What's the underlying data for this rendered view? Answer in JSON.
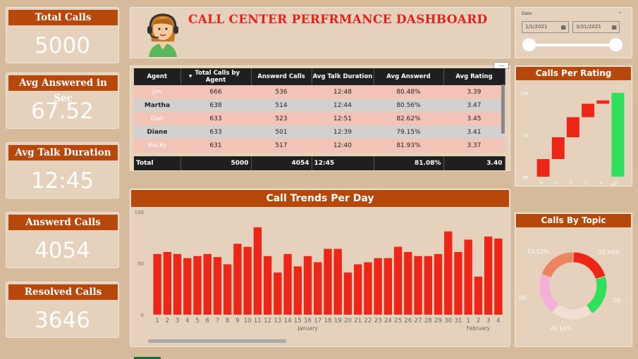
{
  "kpis": [
    {
      "title": "Total Calls",
      "value": "5000"
    },
    {
      "title": "Avg Answered in Sec",
      "value": "67.52"
    },
    {
      "title": "Avg Talk Duration",
      "value": "12:45"
    },
    {
      "title": "Answerd Calls",
      "value": "4054"
    },
    {
      "title": "Resolved Calls",
      "value": "3646"
    }
  ],
  "header": {
    "title": "CALL CENTER PERFRMANCE DASHBOARD"
  },
  "date_slicer": {
    "label": "Date",
    "start": "1/1/2021",
    "end": "3/31/2021",
    "calendar_icon": "calendar-icon"
  },
  "agent_table": {
    "columns": [
      "Agent",
      "Total Calls by Agent",
      "Answerd Calls",
      "Avg Talk Duration",
      "Avg Answerd",
      "Avg Rating"
    ],
    "rows": [
      [
        "Jim",
        "666",
        "536",
        "12:48",
        "80.48%",
        "3.39"
      ],
      [
        "Martha",
        "638",
        "514",
        "12:44",
        "80.56%",
        "3.47"
      ],
      [
        "Dan",
        "633",
        "523",
        "12:51",
        "82.62%",
        "3.45"
      ],
      [
        "Diane",
        "633",
        "501",
        "12:39",
        "79.15%",
        "3.41"
      ],
      [
        "Becky",
        "631",
        "517",
        "12:40",
        "81.93%",
        "3.37"
      ]
    ],
    "total": [
      "Total",
      "5000",
      "4054",
      "12:45",
      "81.08%",
      "3.40"
    ],
    "more_label": "..."
  },
  "colors": {
    "accent": "#b5480a",
    "bar": "#ee2617",
    "positive": "#2fe05c",
    "title_red": "#e5211d"
  },
  "chart_data": [
    {
      "type": "bar",
      "title": "Call Trends Per Day",
      "categories": [
        "1",
        "2",
        "3",
        "4",
        "5",
        "6",
        "7",
        "8",
        "9",
        "10",
        "11",
        "12",
        "13",
        "14",
        "15",
        "16",
        "17",
        "18",
        "19",
        "20",
        "21",
        "22",
        "23",
        "24",
        "25",
        "26",
        "27",
        "28",
        "29",
        "30",
        "31",
        "1",
        "2",
        "3",
        "4"
      ],
      "values": [
        59,
        61,
        59,
        55,
        57,
        59,
        56,
        49,
        69,
        66,
        85,
        57,
        41,
        59,
        47,
        57,
        51,
        64,
        64,
        41,
        49,
        51,
        55,
        55,
        66,
        61,
        57,
        57,
        59,
        81,
        61,
        73,
        37,
        76,
        74
      ],
      "month_labels": [
        "January",
        "February"
      ],
      "ylim": [
        0,
        100
      ],
      "yticks": [
        "0",
        "50",
        "100"
      ]
    },
    {
      "type": "bar",
      "title": "Calls Per Rating",
      "categories": [
        "4",
        "5",
        "3",
        "2",
        "1",
        "Total"
      ],
      "values": [
        1050,
        1300,
        1200,
        800,
        200,
        5000
      ],
      "ylim": [
        0,
        5500
      ],
      "yticks": [
        "0K",
        "5K",
        "10K"
      ]
    },
    {
      "type": "pie",
      "title": "Calls By Topic",
      "slices": [
        {
          "label": "20.44%",
          "value": 20.44,
          "color": "#ee2617"
        },
        {
          "label": "20....",
          "value": 20.1,
          "color": "#2fe05c"
        },
        {
          "label": "20.14%",
          "value": 20.14,
          "color": "#f4ddd3"
        },
        {
          "label": "19....",
          "value": 19.8,
          "color": "#f4b0d8"
        },
        {
          "label": "19.52%",
          "value": 19.52,
          "color": "#ea8560"
        }
      ]
    }
  ]
}
